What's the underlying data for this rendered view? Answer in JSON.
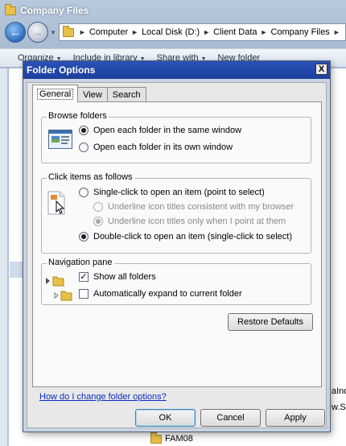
{
  "explorer": {
    "title": "Company Files",
    "breadcrumbs": [
      "Computer",
      "Local Disk (D:)",
      "Client Data",
      "Company Files"
    ],
    "commands": [
      "Organize",
      "Include in library",
      "Share with",
      "New folder"
    ],
    "background_items": [
      "aInd",
      "w.S",
      "FAM08"
    ]
  },
  "dialog": {
    "title": "Folder Options",
    "close_label": "X",
    "tabs": [
      "General",
      "View",
      "Search"
    ],
    "browse_folders": {
      "label": "Browse folders",
      "options": [
        "Open each folder in the same window",
        "Open each folder in its own window"
      ],
      "selected": 0
    },
    "click_items": {
      "label": "Click items as follows",
      "single_click": "Single-click to open an item (point to select)",
      "underline_consistent": "Underline icon titles consistent with my browser",
      "underline_point": "Underline icon titles only when I point at them",
      "double_click": "Double-click to open an item (single-click to select)"
    },
    "navigation_pane": {
      "label": "Navigation pane",
      "show_all_folders": "Show all folders",
      "show_all_folders_checked": true,
      "auto_expand": "Automatically expand to current folder",
      "auto_expand_checked": false
    },
    "restore_defaults": "Restore Defaults",
    "help_link": "How do I change folder options?",
    "buttons": {
      "ok": "OK",
      "cancel": "Cancel",
      "apply": "Apply"
    }
  }
}
